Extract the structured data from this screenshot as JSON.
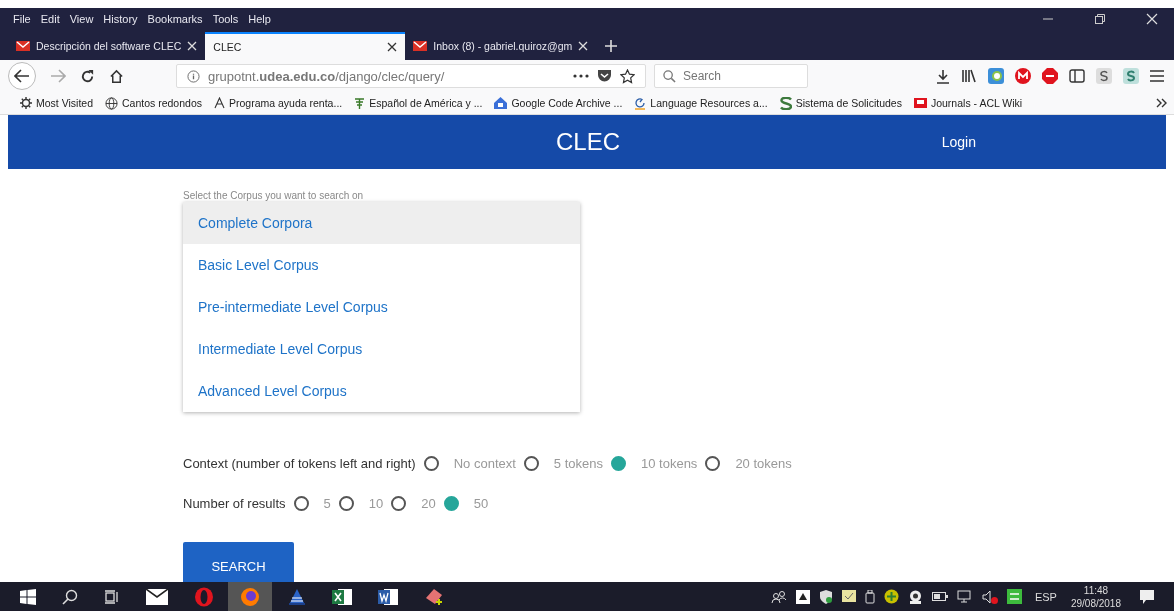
{
  "menu": [
    "File",
    "Edit",
    "View",
    "History",
    "Bookmarks",
    "Tools",
    "Help"
  ],
  "tabs": [
    {
      "title": "Descripción del software CLEC",
      "selected": false,
      "mail_icon": true
    },
    {
      "title": "CLEC",
      "selected": true,
      "mail_icon": false
    },
    {
      "title": "Inbox (8) - gabriel.quiroz@gm",
      "selected": false,
      "mail_icon": true
    }
  ],
  "address": "grupotnt.**udea.edu.co**/django/clec/query/",
  "search": {
    "placeholder": "Search"
  },
  "bookmarks": [
    "Most Visited",
    "Cantos redondos",
    "Programa ayuda renta...",
    "Español de América y ...",
    "Google Code Archive ...",
    "Language Resources a...",
    "Sistema de Solicitudes",
    "Journals - ACL Wiki"
  ],
  "header": {
    "title": "CLEC",
    "login": "Login"
  },
  "corpus": {
    "label": "Select the Corpus you want to search on",
    "items": [
      {
        "label": "Complete Corpora",
        "selected": true
      },
      {
        "label": "Basic Level Corpus",
        "selected": false
      },
      {
        "label": "Pre-intermediate Level Corpus",
        "selected": false
      },
      {
        "label": "Intermediate Level Corpus",
        "selected": false
      },
      {
        "label": "Advanced Level Corpus",
        "selected": false
      }
    ]
  },
  "context": {
    "label": "Context (number of tokens left and right)",
    "options": [
      {
        "label": "No context",
        "selected": false
      },
      {
        "label": "5 tokens",
        "selected": false
      },
      {
        "label": "10 tokens",
        "selected": true
      },
      {
        "label": "20 tokens",
        "selected": false
      }
    ]
  },
  "results": {
    "label": "Number of results",
    "options": [
      {
        "label": "5",
        "selected": false
      },
      {
        "label": "10",
        "selected": false
      },
      {
        "label": "20",
        "selected": false
      },
      {
        "label": "50",
        "selected": true
      }
    ]
  },
  "search_button": "SEARCH",
  "taskbar": {
    "language": "ESP",
    "time": "11:48",
    "date": "29/08/2018"
  }
}
